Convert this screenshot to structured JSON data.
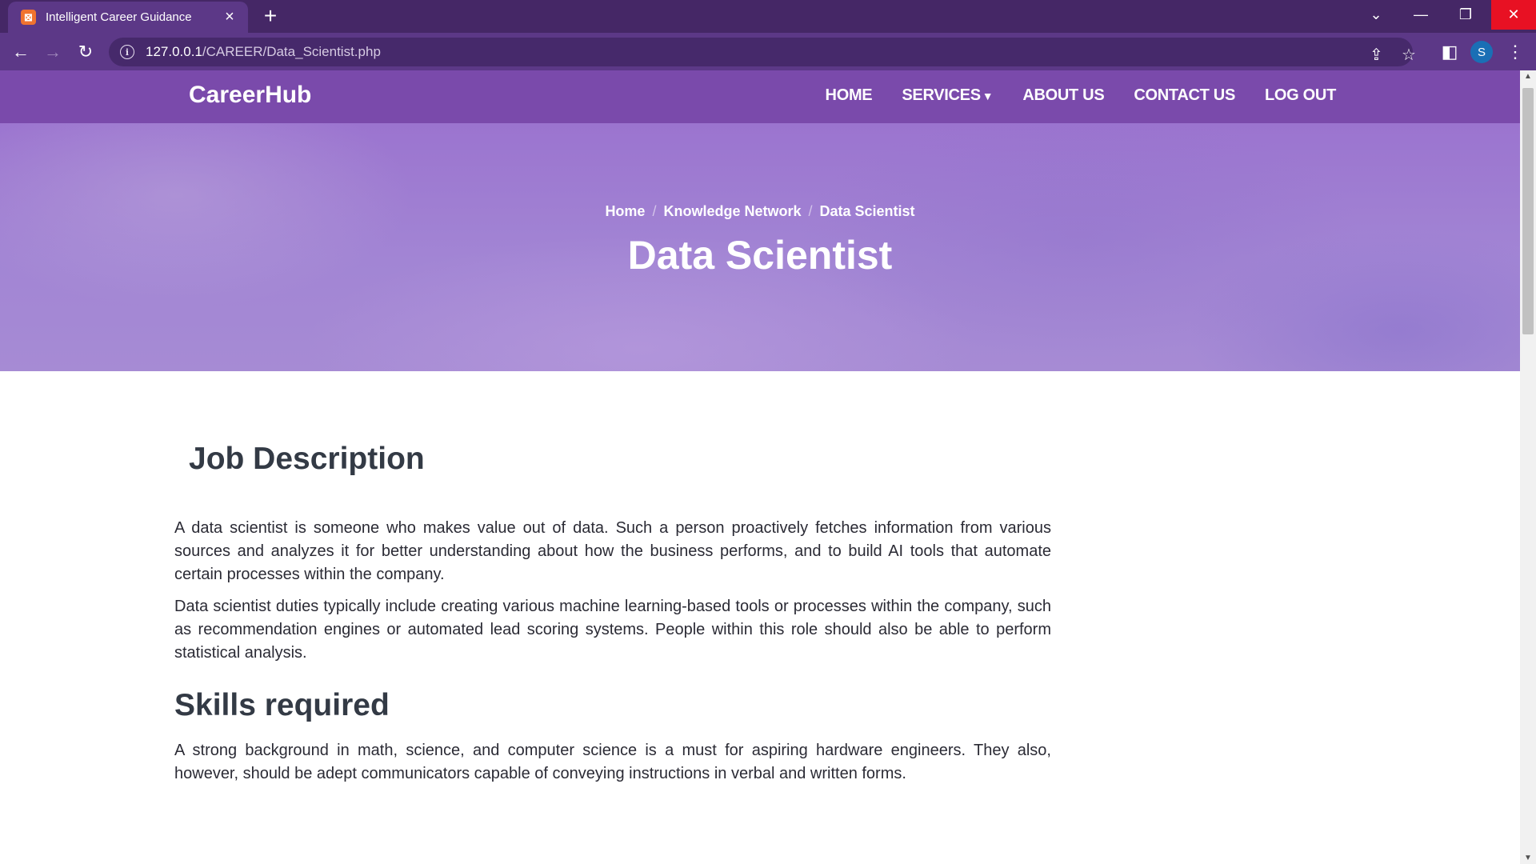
{
  "browser": {
    "tab_title": "Intelligent Career Guidance",
    "tab_favicon": "xampp-icon",
    "url_host": "127.0.0.1",
    "url_path": "/CAREER/Data_Scientist.php",
    "profile_initial": "S"
  },
  "site": {
    "brand": "CareerHub",
    "nav": {
      "home": "HOME",
      "services": "SERVICES",
      "about": "ABOUT US",
      "contact": "CONTACT US",
      "logout": "LOG OUT"
    }
  },
  "hero": {
    "breadcrumb": [
      "Home",
      "Knowledge Network",
      "Data Scientist"
    ],
    "title": "Data Scientist"
  },
  "content": {
    "job_heading": "Job Description",
    "job_paragraphs": [
      "A data scientist is someone who makes value out of data. Such a person proactively fetches information from various sources and analyzes it for better understanding about how the business performs, and to build AI tools that automate certain processes within the company.",
      "Data scientist duties typically include creating various machine learning-based tools or processes within the company, such as recommendation engines or automated lead scoring systems. People within this role should also be able to perform statistical analysis."
    ],
    "skills_heading": "Skills required",
    "skills_paragraph": "A strong background in math, science, and computer science is a must for aspiring hardware engineers. They also, however, should be adept communicators capable of conveying instructions in verbal and written forms."
  },
  "colors": {
    "nav_bg": "#7a4aab",
    "hero_bg": "#a285d4",
    "chrome_bg": "#452766"
  }
}
